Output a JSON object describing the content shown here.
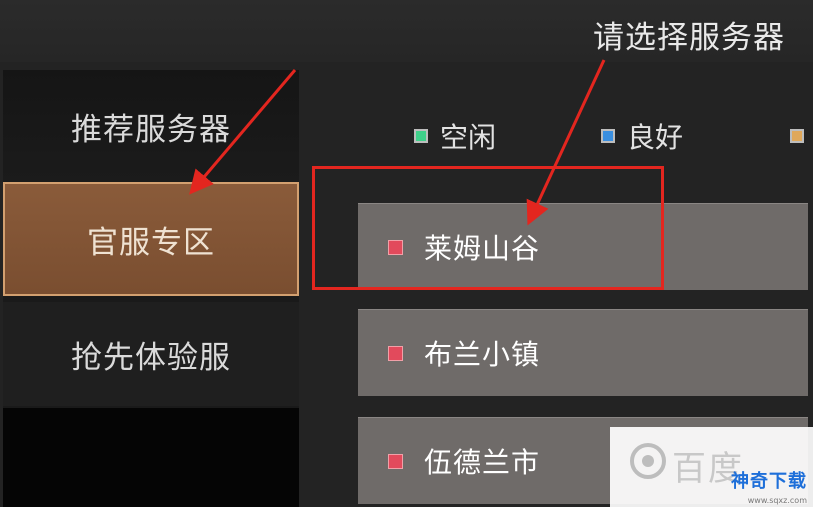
{
  "header": {
    "title": "请选择服务器"
  },
  "sidebar": {
    "items": [
      {
        "label": "推荐服务器"
      },
      {
        "label": "官服专区",
        "selected": true
      },
      {
        "label": "抢先体验服"
      }
    ]
  },
  "legend": [
    {
      "label": "空闲",
      "color": "#3fd08a"
    },
    {
      "label": "良好",
      "color": "#3a8fe0"
    },
    {
      "label": "",
      "color": "#e0a85a"
    }
  ],
  "servers": [
    {
      "name": "莱姆山谷",
      "status_color": "#e24a5c"
    },
    {
      "name": "布兰小镇",
      "status_color": "#e24a5c"
    },
    {
      "name": "伍德兰市",
      "status_color": "#e24a5c"
    }
  ],
  "annotation": {
    "color": "#e3261f"
  },
  "watermark": {
    "brand": "神奇下载",
    "sub": "www.sqxz.com",
    "ghost": "百度"
  }
}
